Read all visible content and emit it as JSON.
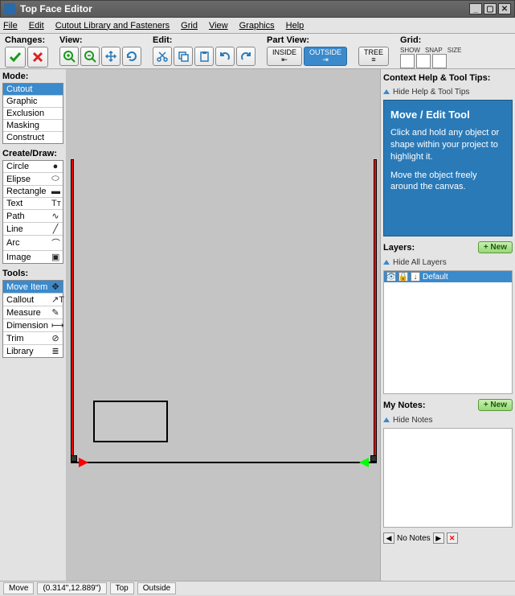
{
  "window": {
    "title": "Top Face Editor"
  },
  "menu": {
    "items": [
      "File",
      "Edit",
      "Cutout Library and Fasteners",
      "Grid",
      "View",
      "Graphics",
      "Help"
    ]
  },
  "toolbar": {
    "changes_label": "Changes:",
    "view_label": "View:",
    "edit_label": "Edit:",
    "partview_label": "Part View:",
    "grid_label": "Grid:",
    "inside": "INSIDE",
    "outside": "OUTSIDE",
    "tree": "TREE",
    "grid_show": "SHOW",
    "grid_snap": "SNAP",
    "grid_size": "SIZE"
  },
  "left": {
    "mode_label": "Mode:",
    "modes": [
      "Cutout",
      "Graphic",
      "Exclusion",
      "Masking",
      "Construct"
    ],
    "create_label": "Create/Draw:",
    "draw": [
      {
        "name": "Circle",
        "icon": "●"
      },
      {
        "name": "Elipse",
        "icon": "⬭"
      },
      {
        "name": "Rectangle",
        "icon": "▬"
      },
      {
        "name": "Text",
        "icon": "Tᴛ"
      },
      {
        "name": "Path",
        "icon": "∿"
      },
      {
        "name": "Line",
        "icon": "╱"
      },
      {
        "name": "Arc",
        "icon": "⌒"
      },
      {
        "name": "Image",
        "icon": "▣"
      }
    ],
    "tools_label": "Tools:",
    "tools": [
      {
        "name": "Move Item",
        "icon": "✥"
      },
      {
        "name": "Callout",
        "icon": "↗T"
      },
      {
        "name": "Measure",
        "icon": "✎"
      },
      {
        "name": "Dimension",
        "icon": "⟼"
      },
      {
        "name": "Trim",
        "icon": "⊘"
      },
      {
        "name": "Library",
        "icon": "≣"
      }
    ]
  },
  "right": {
    "help_header": "Context Help & Tool Tips:",
    "hide_help": "Hide Help & Tool Tips",
    "help_title": "Move / Edit Tool",
    "help_p1": "Click and hold any object or shape within your project to highlight it.",
    "help_p2": "Move the object freely around the canvas.",
    "layers_label": "Layers:",
    "hide_layers": "Hide All Layers",
    "layer_default": "Default",
    "notes_label": "My Notes:",
    "hide_notes": "Hide Notes",
    "new_label": "+ New",
    "no_notes": "No Notes"
  },
  "status": {
    "tool": "Move",
    "coords": "(0.314\",12.889\")",
    "face": "Top",
    "side": "Outside"
  }
}
